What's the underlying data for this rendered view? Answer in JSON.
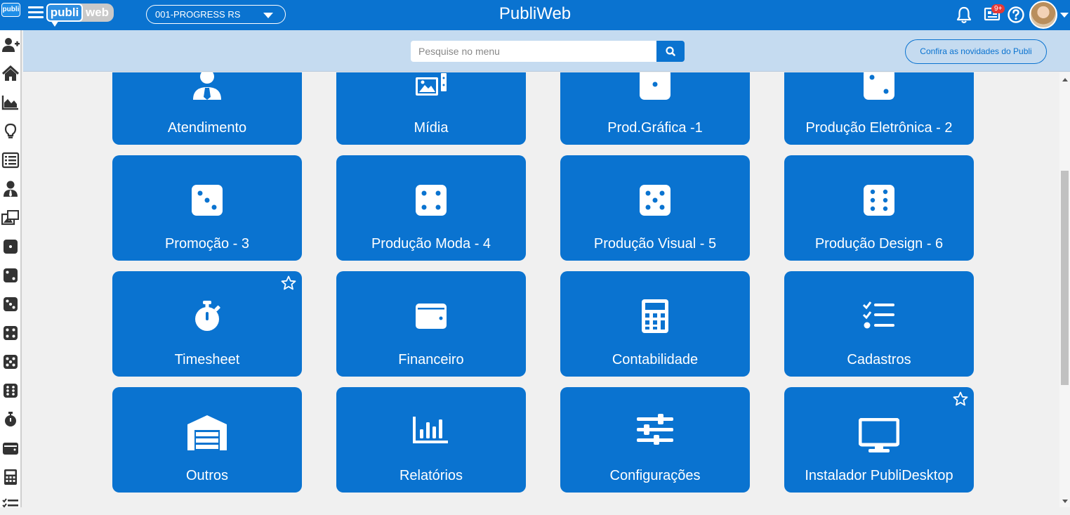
{
  "header": {
    "logo_badge": "publi",
    "brand_publi": "publi",
    "brand_web": "web",
    "company": "001-PROGRESS RS",
    "title": "PubliWeb",
    "notification_count": "9+"
  },
  "search": {
    "placeholder": "Pesquise no menu",
    "news_button": "Confira as novidades do Publi"
  },
  "sidebar": {
    "items": [
      "add-user",
      "home",
      "area-chart",
      "lightbulb",
      "list",
      "user-tie",
      "images",
      "dice-one",
      "dice-two",
      "dice-three",
      "dice-four",
      "dice-five",
      "dice-six",
      "stopwatch",
      "wallet",
      "calculator",
      "tasks"
    ]
  },
  "tiles": [
    {
      "label": "Atendimento",
      "icon": "user-tie-icon",
      "favorite": false
    },
    {
      "label": "Mídia",
      "icon": "images-icon",
      "favorite": false
    },
    {
      "label": "Prod.Gráfica -1",
      "icon": "dice-one-icon",
      "favorite": false
    },
    {
      "label": "Produção Eletrônica - 2",
      "icon": "dice-two-icon",
      "favorite": false
    },
    {
      "label": "Promoção - 3",
      "icon": "dice-three-icon",
      "favorite": false
    },
    {
      "label": "Produção Moda - 4",
      "icon": "dice-four-icon",
      "favorite": false
    },
    {
      "label": "Produção Visual - 5",
      "icon": "dice-five-icon",
      "favorite": false
    },
    {
      "label": "Produção Design - 6",
      "icon": "dice-six-icon",
      "favorite": false
    },
    {
      "label": "Timesheet",
      "icon": "stopwatch-icon",
      "favorite": true
    },
    {
      "label": "Financeiro",
      "icon": "wallet-icon",
      "favorite": false
    },
    {
      "label": "Contabilidade",
      "icon": "calculator-icon",
      "favorite": false
    },
    {
      "label": "Cadastros",
      "icon": "tasks-icon",
      "favorite": false
    },
    {
      "label": "Outros",
      "icon": "warehouse-icon",
      "favorite": false
    },
    {
      "label": "Relatórios",
      "icon": "bar-chart-icon",
      "favorite": false
    },
    {
      "label": "Configurações",
      "icon": "sliders-icon",
      "favorite": false
    },
    {
      "label": "Instalador PubliDesktop",
      "icon": "desktop-icon",
      "favorite": true
    }
  ],
  "colors": {
    "primary": "#0a73d0",
    "subbar": "#c5dbf0",
    "background": "#f0f0f0"
  }
}
